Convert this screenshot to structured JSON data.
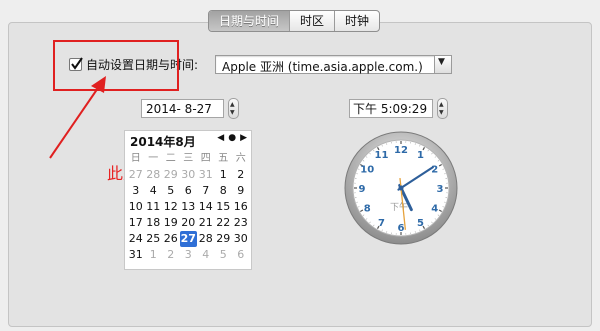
{
  "tabs": [
    {
      "label": "日期与时间",
      "active": true
    },
    {
      "label": "时区",
      "active": false
    },
    {
      "label": "时钟",
      "active": false
    }
  ],
  "auto_setting": {
    "label": "自动设置日期与时间:",
    "checked": true
  },
  "time_server": {
    "value": "Apple 亚洲 (time.asia.apple.com.)"
  },
  "date_field": {
    "value": "2014- 8-27"
  },
  "time_field": {
    "value": "下午  5:09:29"
  },
  "annotation": {
    "text": "此处的勾去掉",
    "color": "#e82323"
  },
  "calendar": {
    "title": "2014年8月",
    "weekdays": [
      "日",
      "一",
      "二",
      "三",
      "四",
      "五",
      "六"
    ],
    "weeks": [
      [
        "27",
        "28",
        "29",
        "30",
        "31",
        "1",
        "2"
      ],
      [
        "3",
        "4",
        "5",
        "6",
        "7",
        "8",
        "9"
      ],
      [
        "10",
        "11",
        "12",
        "13",
        "14",
        "15",
        "16"
      ],
      [
        "17",
        "18",
        "19",
        "20",
        "21",
        "22",
        "23"
      ],
      [
        "24",
        "25",
        "26",
        "27",
        "28",
        "29",
        "30"
      ],
      [
        "31",
        "1",
        "2",
        "3",
        "4",
        "5",
        "6"
      ]
    ],
    "selected_day": "27"
  },
  "clock": {
    "numbers": [
      "12",
      "1",
      "2",
      "3",
      "4",
      "5",
      "6",
      "7",
      "8",
      "9",
      "10",
      "11"
    ],
    "ampm": "下午",
    "hour": 5,
    "minute": 9,
    "second": 29
  },
  "colors": {
    "highlight": "#e02020",
    "selected": "#2f6fd6",
    "clock_numbers": "#2e6aa8",
    "second_hand": "#e6a23c"
  }
}
